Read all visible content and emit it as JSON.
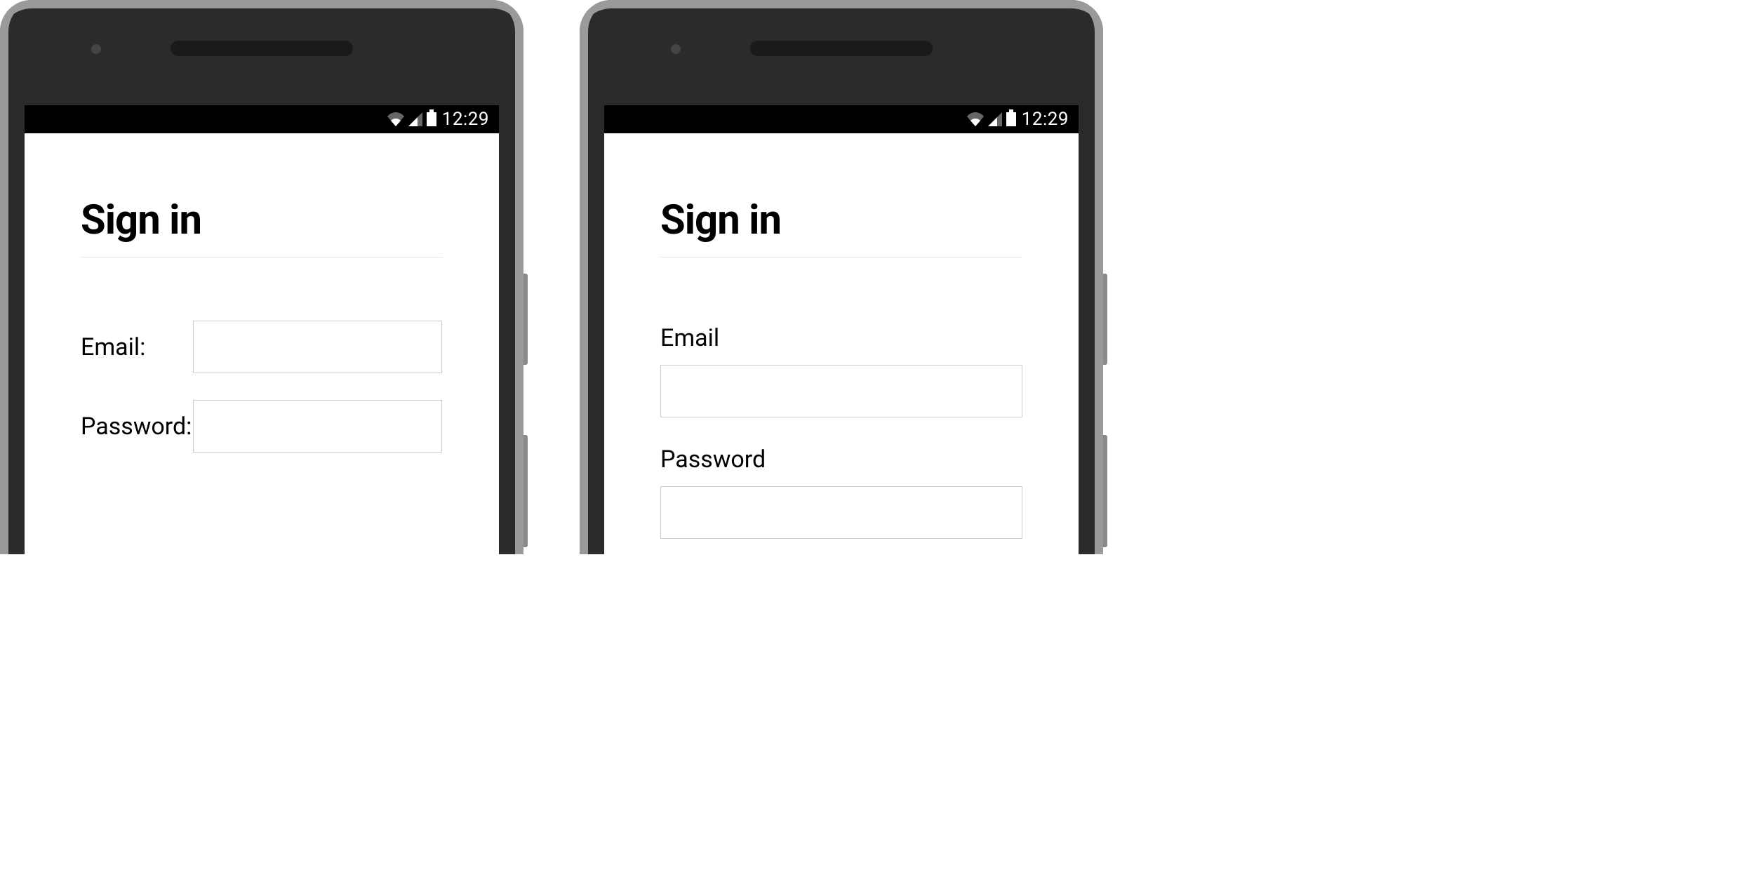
{
  "statusBar": {
    "time": "12:29"
  },
  "leftPhone": {
    "title": "Sign in",
    "emailLabel": "Email:",
    "passwordLabel": "Password:"
  },
  "rightPhone": {
    "title": "Sign in",
    "emailLabel": "Email",
    "passwordLabel": "Password"
  }
}
